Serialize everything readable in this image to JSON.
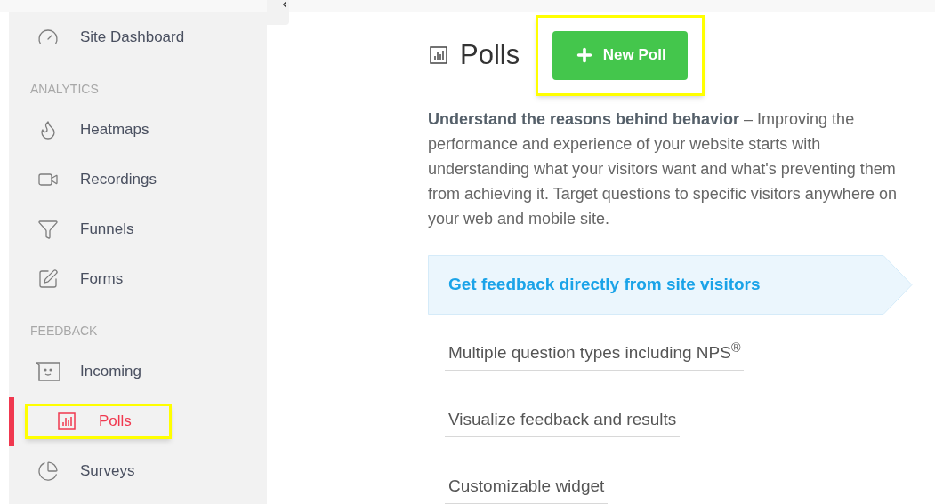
{
  "sidebar": {
    "items": [
      {
        "kind": "link",
        "label": "Site Dashboard",
        "selected": false
      },
      {
        "kind": "heading",
        "label": "ANALYTICS"
      },
      {
        "kind": "link",
        "label": "Heatmaps",
        "selected": false
      },
      {
        "kind": "link",
        "label": "Recordings",
        "selected": false
      },
      {
        "kind": "link",
        "label": "Funnels",
        "selected": false
      },
      {
        "kind": "link",
        "label": "Forms",
        "selected": false
      },
      {
        "kind": "heading",
        "label": "FEEDBACK"
      },
      {
        "kind": "link",
        "label": "Incoming",
        "selected": false
      },
      {
        "kind": "link",
        "label": "Polls",
        "selected": true
      },
      {
        "kind": "link",
        "label": "Surveys",
        "selected": false
      }
    ]
  },
  "page": {
    "title": "Polls",
    "new_button": "New Poll",
    "description": "**Understand the reasons behind behavior** – Improving the performance and experience of your website starts with understanding what your visitors want and what's preventing them from achieving it. Target questions to specific visitors anywhere on your web and mobile site.",
    "features": [
      {
        "label": "Get feedback directly from site visitors",
        "selected": true
      },
      {
        "label": "Multiple question types including NPS$^{®}$",
        "selected": false
      },
      {
        "label": "Visualize feedback and results",
        "selected": false
      },
      {
        "label": "Customizable widget",
        "selected": false
      }
    ]
  }
}
